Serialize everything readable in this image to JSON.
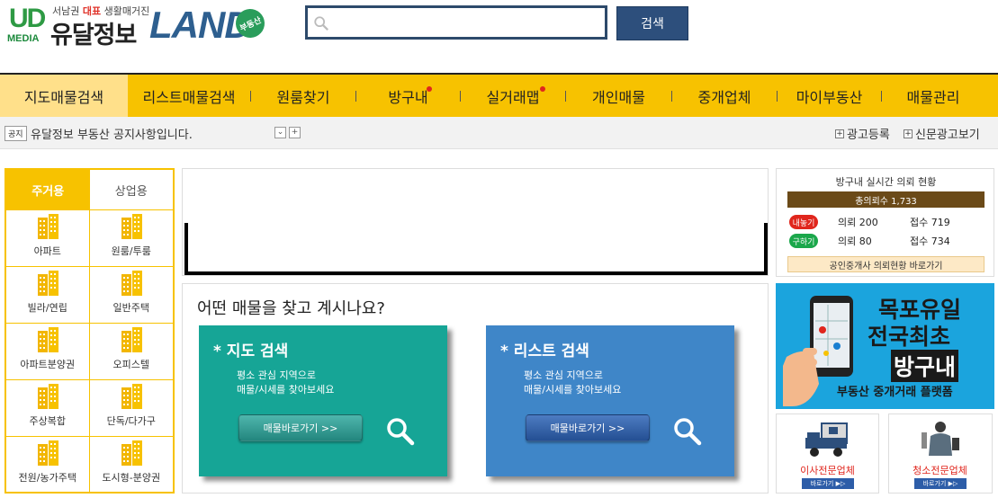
{
  "logo": {
    "ud": "UD",
    "media": "MEDIA",
    "tagline_pre": "서남권 ",
    "tagline_bold": "대표",
    "tagline_post": " 생활매거진",
    "name": "유달정보",
    "land": "LAND",
    "badge": "부동산"
  },
  "search": {
    "placeholder": "",
    "value": "",
    "button_label": "검색"
  },
  "nav": {
    "items": [
      {
        "label": "지도매물검색"
      },
      {
        "label": "리스트매물검색"
      },
      {
        "label": "원룸찾기"
      },
      {
        "label": "방구내"
      },
      {
        "label": "실거래맵"
      },
      {
        "label": "개인매물"
      },
      {
        "label": "중개업체"
      },
      {
        "label": "마이부동산"
      },
      {
        "label": "매물관리"
      }
    ]
  },
  "notice": {
    "tag": "공지",
    "text": "유달정보 부동산 공지사항입니다.",
    "ad_register": "광고등록",
    "newspaper_ad": "신문광고보기"
  },
  "categories": {
    "tabs": [
      "주거용",
      "상업용"
    ],
    "items": [
      {
        "label": "아파트",
        "icon": "apartment-icon"
      },
      {
        "label": "원룸/투룸",
        "icon": "oneroom-icon"
      },
      {
        "label": "빌라/연립",
        "icon": "villa-icon"
      },
      {
        "label": "일반주택",
        "icon": "house-icon"
      },
      {
        "label": "아파트분양권",
        "icon": "presale-icon"
      },
      {
        "label": "오피스텔",
        "icon": "officetel-icon"
      },
      {
        "label": "주상복합",
        "icon": "mixed-use-icon"
      },
      {
        "label": "단독/다가구",
        "icon": "detached-house-icon"
      },
      {
        "label": "전원/농가주택",
        "icon": "country-house-icon"
      },
      {
        "label": "도시형-분양권",
        "icon": "urban-presale-icon"
      }
    ]
  },
  "finder": {
    "title": "어떤 매물을 찾고 계시나요?",
    "map_card": {
      "title": "* 지도 검색",
      "desc1": "평소 관심 지역으로",
      "desc2": "매물/시세를 찾아보세요",
      "button": "매물바로가기 >>"
    },
    "list_card": {
      "title": "* 리스트 검색",
      "desc1": "평소 관심 지역으로",
      "desc2": "매물/시세를 찾아보세요",
      "button": "매물바로가기 >>"
    }
  },
  "requests": {
    "title": "방구내 실시간 의뢰 현황",
    "total": "총의뢰수 1,733",
    "rows": [
      {
        "badge": "내놓기",
        "inquiry": "의뢰 200",
        "accept": "접수 719"
      },
      {
        "badge": "구하기",
        "inquiry": "의뢰 80",
        "accept": "접수 734"
      }
    ],
    "link": "공인중개사 의뢰현황 바로가기"
  },
  "ad": {
    "line1": "목포유일",
    "line2": "전국최초",
    "line3": "방구내",
    "line4": "부동산 중개거래 플랫폼"
  },
  "services": [
    {
      "label": "이사전문업체",
      "button": "바로가기 ▶▷",
      "icon": "moving-truck-icon"
    },
    {
      "label": "청소전문업체",
      "button": "바로가기 ▶▷",
      "icon": "cleaning-worker-icon"
    }
  ],
  "colors": {
    "nav_yellow": "#f7c200",
    "map_card": "#16a596",
    "list_card": "#3f86c8",
    "search_border": "#2d4a6b"
  }
}
